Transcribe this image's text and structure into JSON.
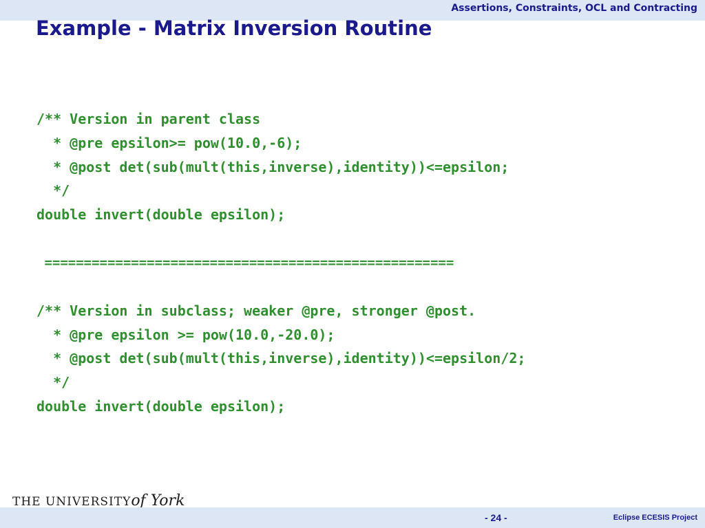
{
  "header": {
    "course_title": "Assertions, Constraints, OCL and Contracting",
    "slide_title": "Example - Matrix Inversion Routine"
  },
  "code": {
    "lines": [
      "/** Version in parent class",
      "  * @pre epsilon>= pow(10.0,-6);",
      "  * @post det(sub(mult(this,inverse),identity))<=epsilon;",
      "  */",
      "double invert(double epsilon);",
      " ====================================================",
      "/** Version in subclass; weaker @pre, stronger @post.",
      "  * @pre epsilon >= pow(10.0,-20.0);",
      "  * @post det(sub(mult(this,inverse),identity))<=epsilon/2;",
      "  */",
      "double invert(double epsilon);"
    ]
  },
  "footer": {
    "logo_text": "THE UNIVERSITY",
    "logo_script": "of York",
    "page_number": "- 24 -",
    "project": "Eclipse ECESIS Project"
  },
  "colors": {
    "title": "#1a1a8c",
    "code": "#2f8f2f",
    "band": "#dce6f4"
  }
}
